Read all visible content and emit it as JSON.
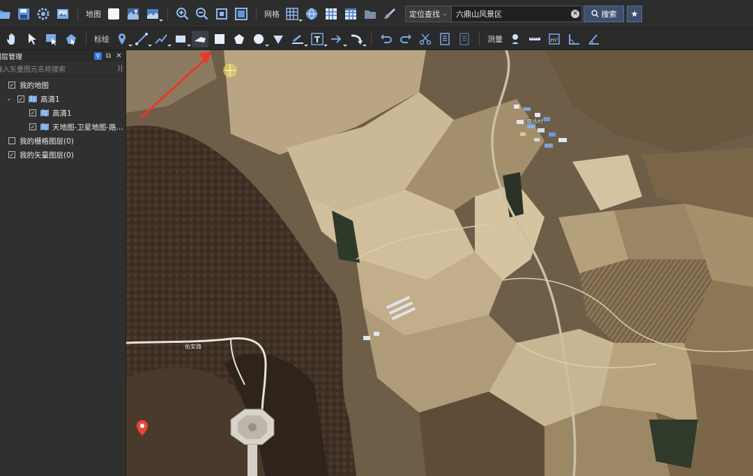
{
  "toolbar_top": {
    "map_label": "地图",
    "grid_label": "网格",
    "search_mode": "定位查找",
    "search_value": "六鼎山风景区",
    "search_button": "搜索"
  },
  "toolbar_draw": {
    "annotate_label": "标绘",
    "measure_label": "测量"
  },
  "layer_panel": {
    "title": "图层管理",
    "filter_placeholder": "输入矢量图元名称搜索",
    "tree": [
      {
        "label": "我的地图",
        "checked": true
      },
      {
        "label": "高清1",
        "checked": true
      },
      {
        "label": "高清1",
        "checked": true
      },
      {
        "label": "天地图-卫星地图-路...",
        "checked": true
      },
      {
        "label": "我的栅格图层(0)",
        "checked": false
      },
      {
        "label": "我的矢量图层(0)",
        "checked": true
      }
    ]
  },
  "map": {
    "labels": {
      "village": "鹿场村",
      "road_west": "佑安路"
    },
    "colors": {
      "annotation_arrow": "#e8382c",
      "marker": "#e8473a"
    }
  }
}
